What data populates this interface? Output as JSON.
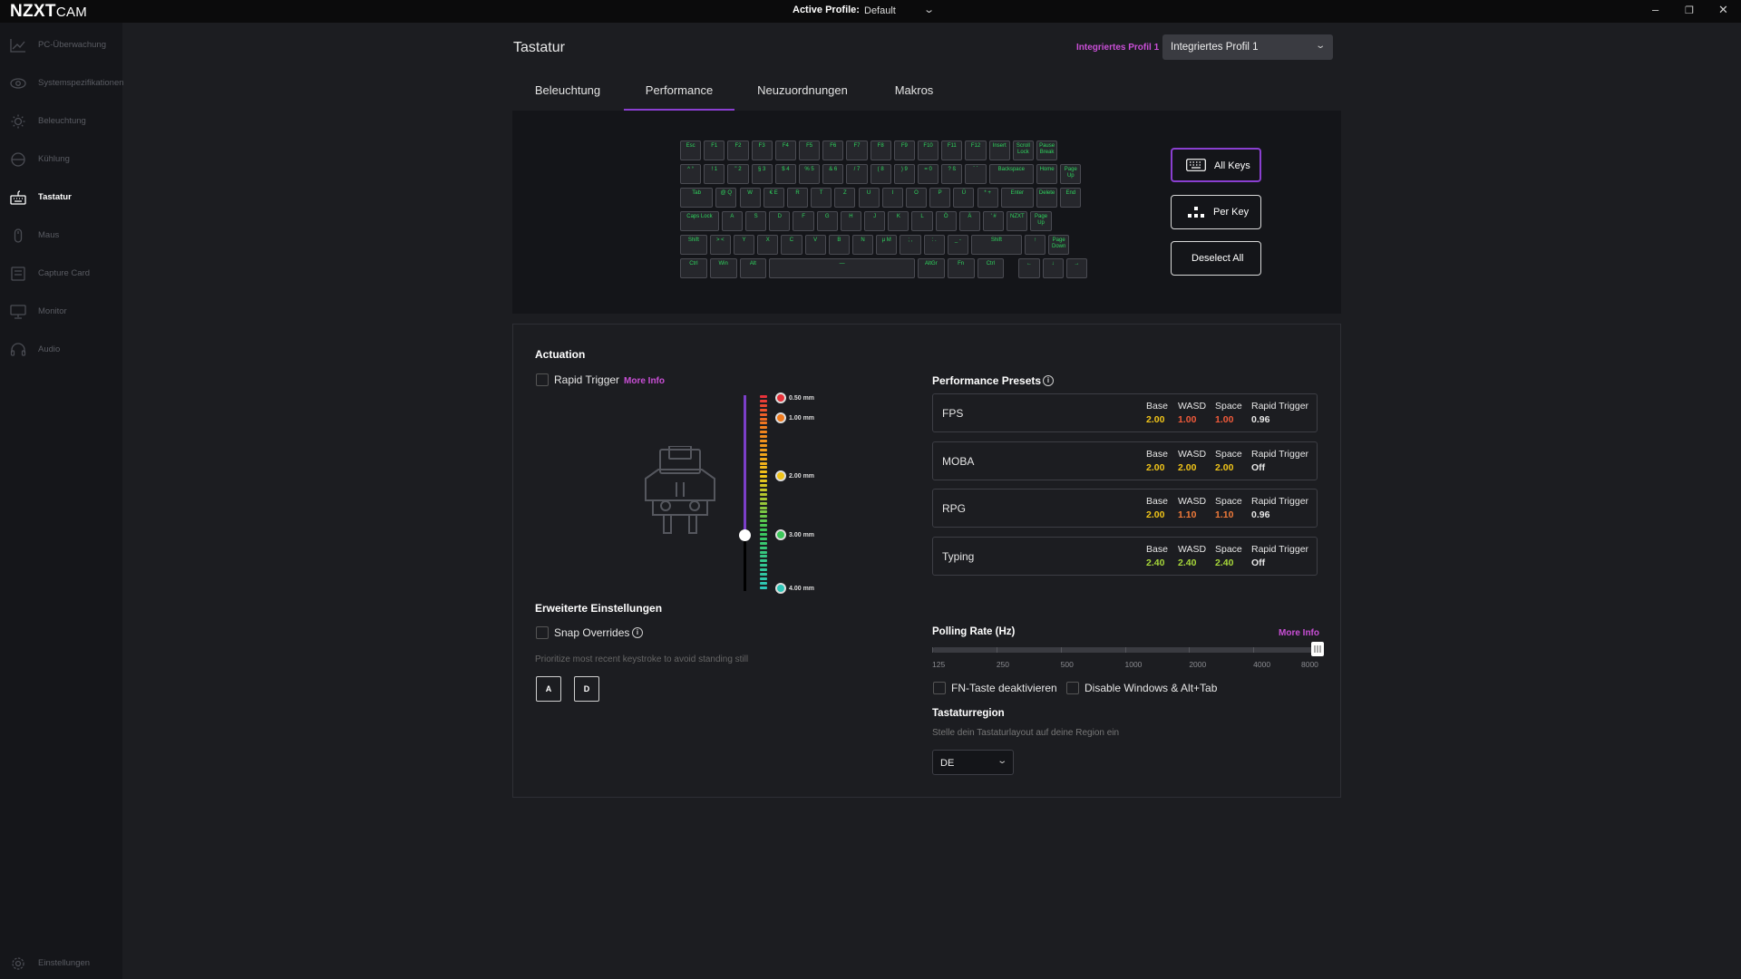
{
  "app": {
    "logo_bold": "NZXT",
    "logo_light": "CAM",
    "active_profile_label": "Active Profile:",
    "active_profile_value": "Default"
  },
  "sidebar": {
    "items": [
      {
        "label": "PC-Überwachung",
        "icon": "chart-line-icon"
      },
      {
        "label": "Systemspezifikationen",
        "icon": "eye-icon"
      },
      {
        "label": "Beleuchtung",
        "icon": "sun-icon"
      },
      {
        "label": "Kühlung",
        "icon": "fan-icon"
      },
      {
        "label": "Tastatur",
        "icon": "keyboard-icon",
        "active": true
      },
      {
        "label": "Maus",
        "icon": "mouse-icon"
      },
      {
        "label": "Capture Card",
        "icon": "capture-card-icon"
      },
      {
        "label": "Monitor",
        "icon": "monitor-icon"
      },
      {
        "label": "Audio",
        "icon": "headset-icon"
      }
    ],
    "settings_label": "Einstellungen"
  },
  "header": {
    "title": "Tastatur",
    "profile_label": "Integriertes Profil 1",
    "profile_value": "Integriertes Profil 1"
  },
  "tabs": [
    {
      "label": "Beleuchtung"
    },
    {
      "label": "Performance",
      "active": true
    },
    {
      "label": "Neuzuordnungen"
    },
    {
      "label": "Makros"
    }
  ],
  "keyboard": {
    "key_color": "#2fd65e",
    "rows": [
      [
        "Esc",
        "F1",
        "F2",
        "F3",
        "F4",
        "F5",
        "F6",
        "F7",
        "F8",
        "F9",
        "F10",
        "F11",
        "F12",
        "Insert",
        "Scroll Lock",
        "Pause Break"
      ],
      [
        "^ °",
        "! 1",
        "\" 2",
        "§ 3",
        "$ 4",
        "% 5",
        "& 6",
        "/ 7",
        "( 8",
        ") 9",
        "= 0",
        "? ß",
        "` ´",
        "Backspace",
        "Home",
        "Page Up"
      ],
      [
        "Tab",
        "@ Q",
        "W",
        "€ E",
        "R",
        "T",
        "Z",
        "U",
        "I",
        "O",
        "P",
        "Ü",
        "* +",
        "Enter",
        "Delete",
        "End"
      ],
      [
        "Caps Lock",
        "A",
        "S",
        "D",
        "F",
        "G",
        "H",
        "J",
        "K",
        "L",
        "Ö",
        "Ä",
        "' #",
        "NZXT",
        "Page Up"
      ],
      [
        "Shift",
        "> <",
        "Y",
        "X",
        "C",
        "V",
        "B",
        "N",
        "µ M",
        "; ,",
        ": .",
        "_ -",
        "Shift",
        "↑",
        "Page Down"
      ],
      [
        "Ctrl",
        "Win",
        "Alt",
        "—",
        "AltGr",
        "Fn",
        "Ctrl",
        "←",
        "↓",
        "→"
      ]
    ]
  },
  "modes": {
    "all_keys": "All Keys",
    "per_key": "Per Key",
    "deselect_all": "Deselect All"
  },
  "actuation": {
    "title": "Actuation",
    "rapid_trigger_label": "Rapid Trigger",
    "more_info": "More Info",
    "current_mm": 3.0,
    "levels": [
      "0.50 mm",
      "1.00 mm",
      "2.00 mm",
      "3.00 mm",
      "4.00 mm"
    ]
  },
  "advanced": {
    "title": "Erweiterte Einstellungen",
    "snap_label": "Snap Overrides",
    "description": "Prioritize most recent keystroke to avoid standing still",
    "key_a": "A",
    "key_d": "D"
  },
  "presets": {
    "title": "Performance Presets",
    "col_base": "Base",
    "col_wasd": "WASD",
    "col_space": "Space",
    "col_rt": "Rapid Trigger",
    "items": [
      {
        "name": "FPS",
        "base": "2.00",
        "wasd": "1.00",
        "space": "1.00",
        "rt": "0.96",
        "base_color": "#f0c419",
        "wasd_color": "#f05a3a",
        "space_color": "#f05a3a"
      },
      {
        "name": "MOBA",
        "base": "2.00",
        "wasd": "2.00",
        "space": "2.00",
        "rt": "Off",
        "base_color": "#f0c419",
        "wasd_color": "#f0c419",
        "space_color": "#f0c419"
      },
      {
        "name": "RPG",
        "base": "2.00",
        "wasd": "1.10",
        "space": "1.10",
        "rt": "0.96",
        "base_color": "#f0c419",
        "wasd_color": "#f07a3a",
        "space_color": "#f07a3a"
      },
      {
        "name": "Typing",
        "base": "2.40",
        "wasd": "2.40",
        "space": "2.40",
        "rt": "Off",
        "base_color": "#a6d63a",
        "wasd_color": "#a6d63a",
        "space_color": "#a6d63a"
      }
    ]
  },
  "polling": {
    "title": "Polling Rate (Hz)",
    "more_info": "More Info",
    "labels": [
      "125",
      "250",
      "500",
      "1000",
      "2000",
      "4000",
      "8000"
    ],
    "selected": "8000"
  },
  "options": {
    "fn_label": "FN-Taste deaktivieren",
    "win_label": "Disable Windows & Alt+Tab"
  },
  "region": {
    "title": "Tastaturregion",
    "description": "Stelle dein Tastaturlayout auf deine Region ein",
    "value": "DE"
  },
  "colors": {
    "accent": "#8a3fd0",
    "link": "#c94fd6"
  }
}
